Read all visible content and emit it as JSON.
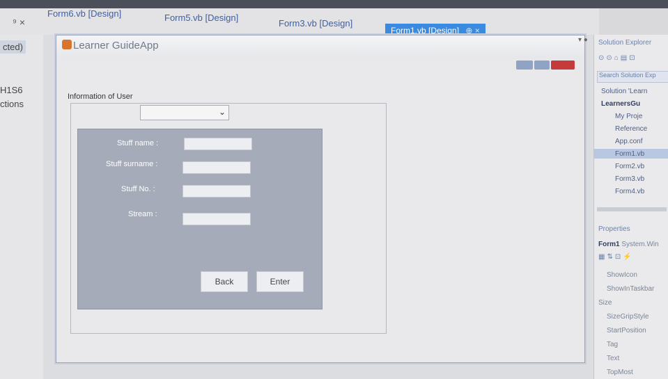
{
  "tabs": {
    "close_glyph": "⁹ ×",
    "items": [
      {
        "label": "Form6.vb [Design]"
      },
      {
        "label": "Form5.vb [Design]"
      },
      {
        "label": "Form3.vb [Design]"
      },
      {
        "label": "Form1.vb [Design]",
        "suffix": "⊕ ×",
        "active": true
      }
    ]
  },
  "left_panel": {
    "items": [
      {
        "label": "cted)"
      },
      {
        "label": "H1S6"
      },
      {
        "label": "ctions"
      }
    ]
  },
  "form": {
    "title": "Learner GuideApp",
    "group_label": "Information of User",
    "combo_value": "",
    "fields": [
      {
        "label": "Stuff name :",
        "value": ""
      },
      {
        "label": "Stuff surname :",
        "value": ""
      },
      {
        "label": "Stuff No. :",
        "value": ""
      },
      {
        "label": "Stream :",
        "value": ""
      }
    ],
    "back_label": "Back",
    "enter_label": "Enter"
  },
  "solution_explorer": {
    "title": "Solution Explorer",
    "search_placeholder": "Search Solution Exp",
    "items": [
      {
        "label": "Solution 'Learn"
      },
      {
        "label": "LearnersGu"
      },
      {
        "label": "My Proje"
      },
      {
        "label": "Reference"
      },
      {
        "label": "App.conf"
      },
      {
        "label": "Form1.vb"
      },
      {
        "label": "Form2.vb"
      },
      {
        "label": "Form3.vb"
      },
      {
        "label": "Form4.vb"
      }
    ]
  },
  "properties": {
    "title": "Properties",
    "object": "Form1",
    "object_type": "System.Win",
    "rows": [
      "ShowIcon",
      "ShowInTaskbar",
      "Size",
      "SizeGripStyle",
      "StartPosition",
      "Tag",
      "Text",
      "TopMost"
    ]
  }
}
